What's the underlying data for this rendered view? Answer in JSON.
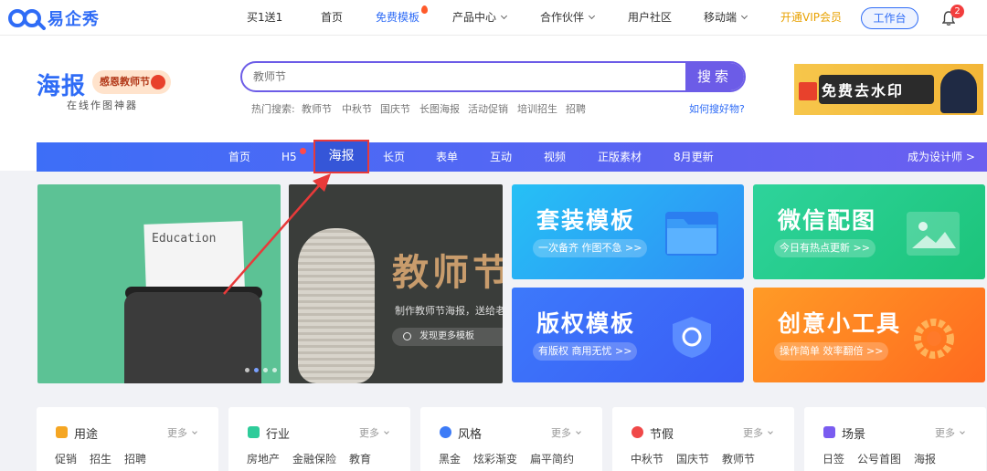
{
  "topnav": {
    "logo_text": "易企秀",
    "items": [
      {
        "label": "买1送1"
      },
      {
        "label": "首页"
      },
      {
        "label": "免费模板"
      },
      {
        "label": "产品中心"
      },
      {
        "label": "合作伙伴"
      },
      {
        "label": "用户社区"
      },
      {
        "label": "移动端"
      },
      {
        "label": "开通VIP会员"
      }
    ],
    "workbench": "工作台",
    "notification_count": "2"
  },
  "brand": {
    "title": "海报",
    "tag": "感恩教师节",
    "subtitle": "在线作图神器"
  },
  "search": {
    "placeholder": "教师节",
    "button": "搜索",
    "hot_label": "热门搜索:",
    "hot_terms": [
      "教师节",
      "中秋节",
      "国庆节",
      "长图海报",
      "活动促销",
      "培训招生",
      "招聘"
    ],
    "help_link": "如何搜好物?"
  },
  "watermark_ad": {
    "text": "免费去水印"
  },
  "categories": {
    "items": [
      "首页",
      "H5",
      "海报",
      "长页",
      "表单",
      "互动",
      "视频",
      "正版素材",
      "8月更新"
    ],
    "active_index": 2,
    "designer_link": "成为设计师 >"
  },
  "banners": {
    "typewriter_text": "Education",
    "teacher_title": "教师节",
    "teacher_desc": "制作教师节海报，送给老",
    "teacher_more": "发现更多模板"
  },
  "tiles": [
    {
      "title": "套装模板",
      "sub": "一次备齐 作图不急 >>"
    },
    {
      "title": "微信配图",
      "sub": "今日有热点更新 >>"
    },
    {
      "title": "版权模板",
      "sub": "有版权 商用无忧 >>"
    },
    {
      "title": "创意小工具",
      "sub": "操作简单 效率翻倍 >>"
    }
  ],
  "filter_cards": [
    {
      "title": "用途",
      "more": "更多",
      "tags": [
        "促销",
        "招生",
        "招聘"
      ],
      "color": "#f5a623"
    },
    {
      "title": "行业",
      "more": "更多",
      "tags": [
        "房地产",
        "金融保险",
        "教育"
      ],
      "color": "#2ecc9a"
    },
    {
      "title": "风格",
      "more": "更多",
      "tags": [
        "黑金",
        "炫彩渐变",
        "扁平简约"
      ],
      "color": "#3d7bf7"
    },
    {
      "title": "节假",
      "more": "更多",
      "tags": [
        "中秋节",
        "国庆节",
        "教师节"
      ],
      "color": "#f04848"
    },
    {
      "title": "场景",
      "more": "更多",
      "tags": [
        "日签",
        "公号首图",
        "海报"
      ],
      "color": "#7a5cf0"
    }
  ],
  "colors": {
    "brand_blue": "#2f6cf6",
    "search_purple": "#6c5ce7",
    "vip_gold": "#e8a100",
    "highlight_red": "#e83a3a"
  }
}
